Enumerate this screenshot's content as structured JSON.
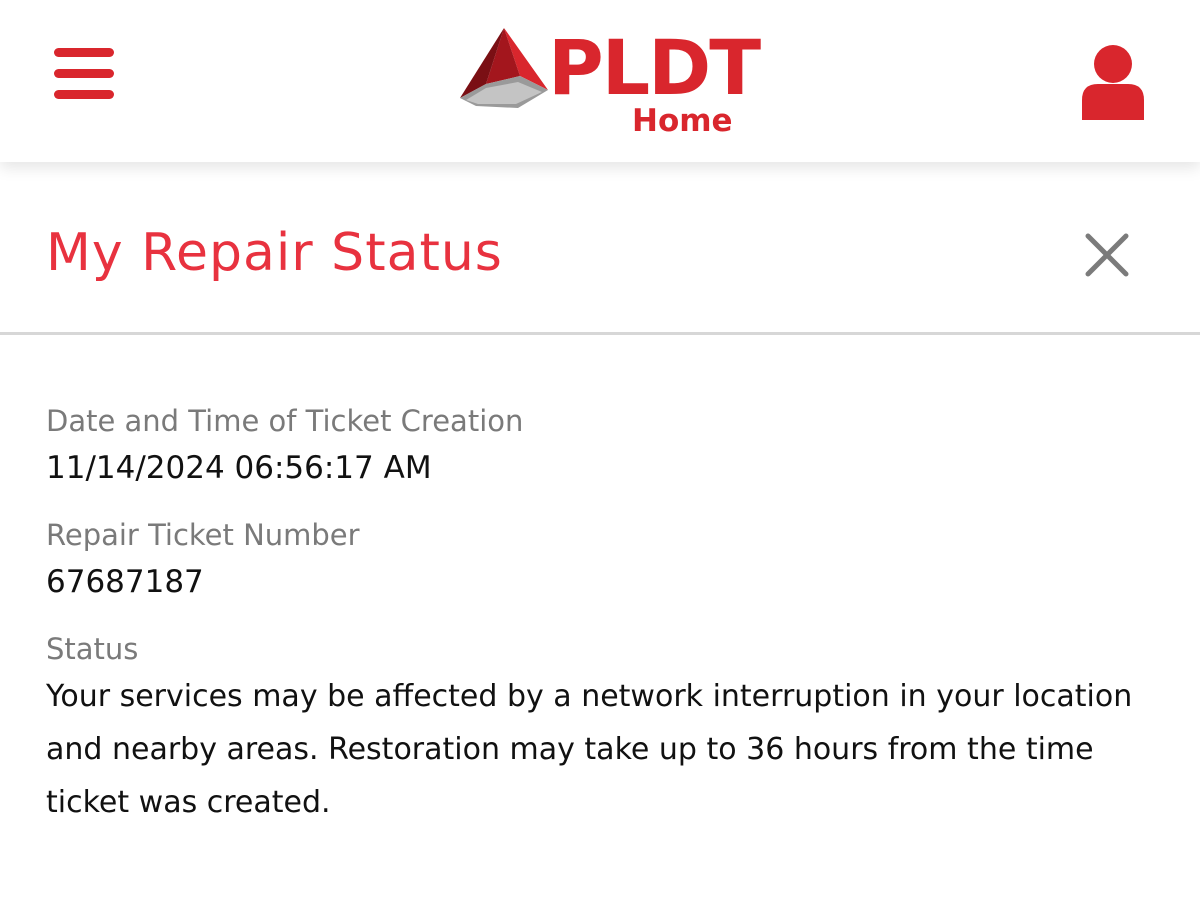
{
  "colors": {
    "brand_red": "#d9262d",
    "title_red": "#e8323f",
    "label_gray": "#7a7a7a",
    "close_gray": "#7b7b7b"
  },
  "header": {
    "menu_icon": "hamburger-menu-icon",
    "logo": {
      "wordmark": "PLDT",
      "subtitle": "Home"
    },
    "account_icon": "user-account-icon"
  },
  "title_bar": {
    "title": "My Repair Status",
    "close_icon": "close-icon"
  },
  "details": {
    "created": {
      "label": "Date and Time of Ticket Creation",
      "value": "11/14/2024 06:56:17 AM"
    },
    "ticket": {
      "label": "Repair Ticket Number",
      "value": "67687187"
    },
    "status": {
      "label": "Status",
      "value": "Your services may be affected by a network interruption in your location and nearby areas. Restoration may take up to 36 hours from the time ticket was created."
    }
  }
}
